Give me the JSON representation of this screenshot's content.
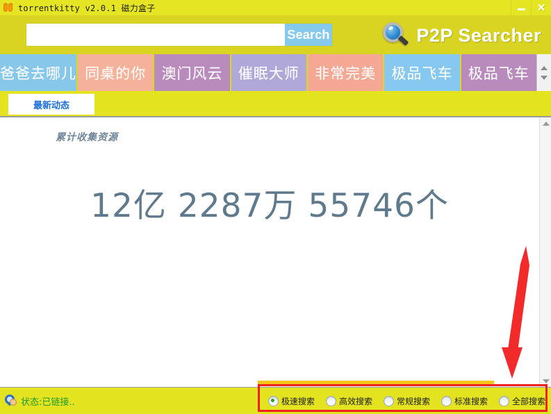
{
  "window": {
    "title": "torrentkitty  v2.0.1 磁力盒子",
    "icon": "kitty-icon",
    "minimize_label": "—",
    "close_label": "✕"
  },
  "search": {
    "value": "",
    "placeholder": "",
    "button_label": "Search"
  },
  "brand": {
    "name": "P2P Searcher",
    "logo": "magnifier-icon"
  },
  "movie_tabs": [
    {
      "label": "爸爸去哪儿",
      "color": "#87c7ea"
    },
    {
      "label": "同桌的你",
      "color": "#f5b19a"
    },
    {
      "label": "澳门风云",
      "color": "#b98bbd"
    },
    {
      "label": "催眠大师",
      "color": "#b0a8d8"
    },
    {
      "label": "非常完美",
      "color": "#f5a894"
    },
    {
      "label": "极品飞车",
      "color": "#86c8ef"
    },
    {
      "label": "极品飞车",
      "color": "#b98bbd"
    }
  ],
  "tab_spinner": {
    "up_icon": "chevron-up-icon",
    "down_icon": "chevron-down-icon"
  },
  "sub_tabs": [
    {
      "label": "最新动态",
      "active": true
    }
  ],
  "content": {
    "accum_label": "累计收集资源",
    "big_number": "12亿 2287万 55746个"
  },
  "scrollbar": {
    "up_icon": "scroll-up-arrow-icon",
    "down_icon": "scroll-down-arrow-icon"
  },
  "status": {
    "icon": "connection-status-icon",
    "text": "状态:已链接.."
  },
  "search_modes": [
    {
      "label": "极速搜索",
      "checked": true
    },
    {
      "label": "高效搜索",
      "checked": false
    },
    {
      "label": "常规搜索",
      "checked": false
    },
    {
      "label": "标准搜索",
      "checked": false
    },
    {
      "label": "全部搜索",
      "checked": false
    }
  ],
  "annotations": {
    "highlight_color": "#f02020",
    "box_target": "search_modes",
    "arrow": "red-down-arrow"
  },
  "colors": {
    "window_bg": "#e3e31f",
    "search_band": "#d9d421",
    "search_button": "#85c9ec",
    "status_text": "#1f9a2e",
    "big_number": "#5f7a8c",
    "subtab_text": "#1b6fd8"
  }
}
